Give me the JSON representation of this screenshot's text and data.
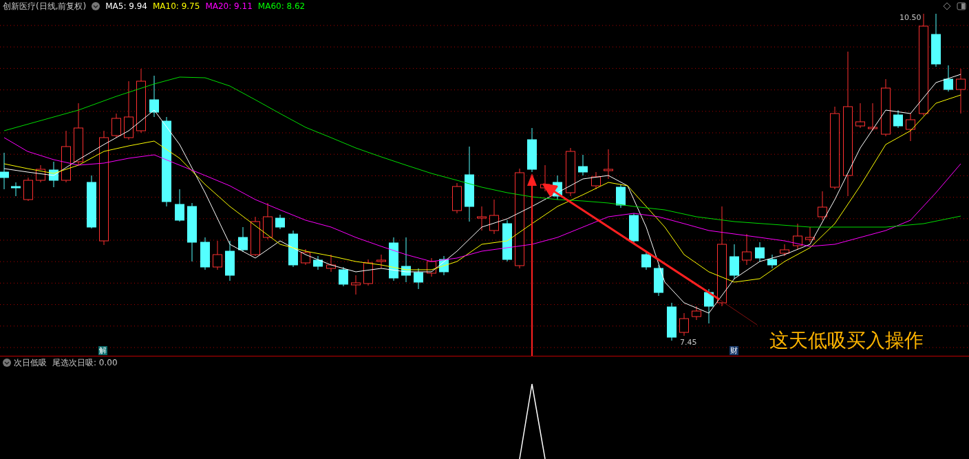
{
  "header": {
    "title": "创新医疗(日线,前复权)",
    "indicators": [
      {
        "label": "MA5: 9.94",
        "color": "#ffffff"
      },
      {
        "label": "MA10: 9.75",
        "color": "#ffff00"
      },
      {
        "label": "MA20: 9.11",
        "color": "#ff00ff"
      },
      {
        "label": "MA60: 8.62",
        "color": "#00ff00"
      }
    ]
  },
  "main_chart": {
    "high_label": "10.50",
    "low_label": "7.45",
    "event_markers": [
      "解",
      "财"
    ],
    "annotation": "这天低吸买入操作"
  },
  "sub_panel": {
    "title": "次日低吸",
    "indicator": "尾选次日吸: 0.00"
  }
}
